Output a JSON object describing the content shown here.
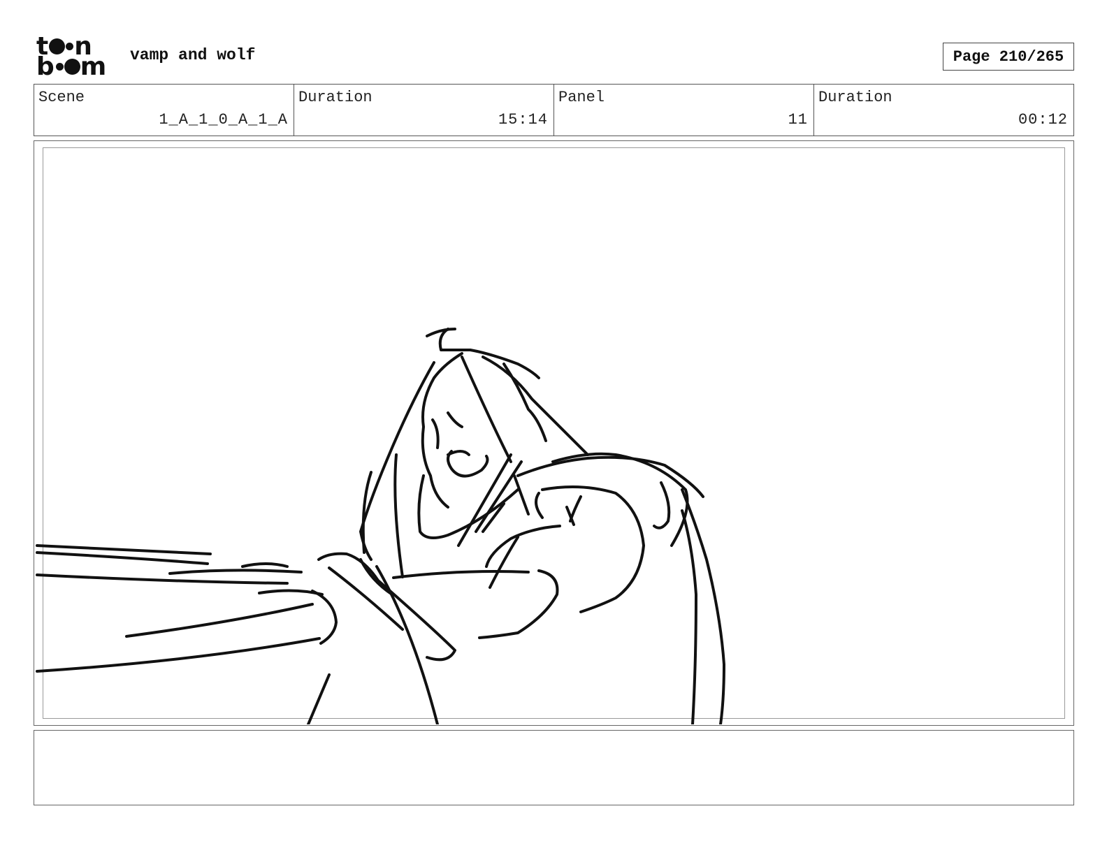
{
  "header": {
    "logo_text_top": "toon",
    "logo_text_bottom": "boom",
    "project_title": "vamp and wolf",
    "page_label": "Page 210/265"
  },
  "info": {
    "scene_label": "Scene",
    "scene_value": "1_A_1_0_A_1_A",
    "scene_duration_label": "Duration",
    "scene_duration_value": "15:14",
    "panel_label": "Panel",
    "panel_value": "11",
    "panel_duration_label": "Duration",
    "panel_duration_value": "00:12"
  },
  "notes": {
    "text": ""
  },
  "colors": {
    "ink": "#111111",
    "border": "#555555",
    "background": "#ffffff"
  }
}
